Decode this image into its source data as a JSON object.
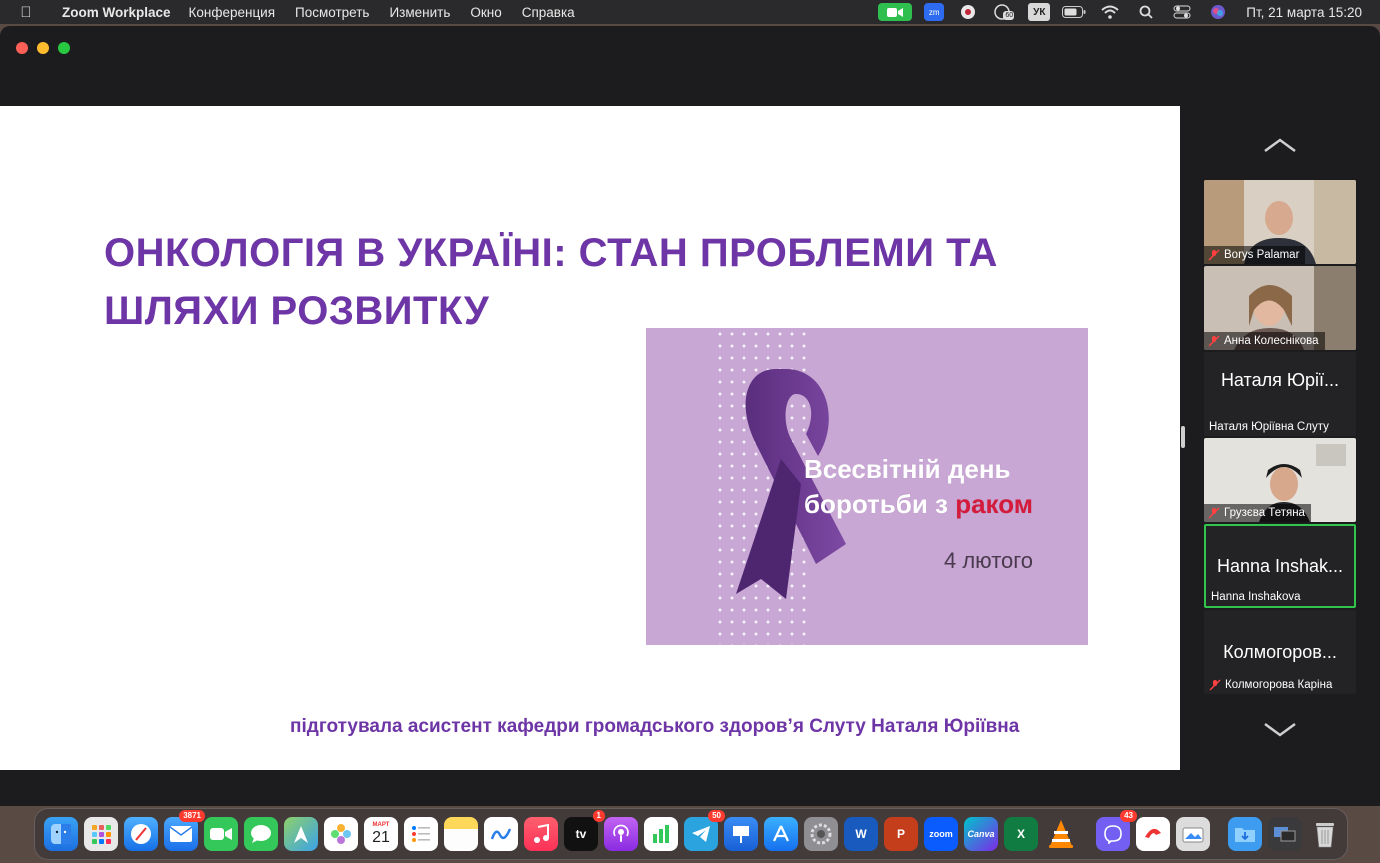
{
  "menubar": {
    "app_name": "Zoom Workplace",
    "menus": [
      "Конференция",
      "Посмотреть",
      "Изменить",
      "Окно",
      "Справка"
    ],
    "keyboard_layout": "УК",
    "notification_count": "60",
    "zm_label": "zm",
    "clock": "Пт, 21 марта  15:20"
  },
  "slide": {
    "title": "ОНКОЛОГІЯ В УКРАЇНІ: СТАН ПРОБЛЕМИ ТА ШЛЯХИ РОЗВИТКУ",
    "image_text_1": "Всесвітній день",
    "image_text_2": "боротьби з",
    "image_text_accent": "раком",
    "image_date": "4 лютого",
    "author": "підготувала асистент кафедри громадського здоров’я Слуту Наталя Юріївна",
    "colors": {
      "title": "#6d35a6",
      "ribbon": "#6b3a8f",
      "accent": "#d41b3c",
      "image_bg": "#c8a7d4"
    }
  },
  "participants": [
    {
      "label": "Borys Palamar",
      "muted": true,
      "video": true
    },
    {
      "label": "Анна Колеснікова",
      "muted": true,
      "video": true
    },
    {
      "big_name": "Наталя Юрії...",
      "label": "Наталя Юріївна Слуту",
      "muted": false,
      "video": false
    },
    {
      "label": "Грузєва Тетяна",
      "muted": true,
      "video": true
    },
    {
      "big_name": "Hanna Inshak...",
      "label": "Hanna Inshakova",
      "muted": false,
      "video": false,
      "active": true
    },
    {
      "big_name": "Колмогоров...",
      "label": "Колмогорова Каріна",
      "muted": true,
      "video": false
    }
  ],
  "dock": {
    "mail_badge": "3871",
    "calendar_month": "МАРТ",
    "calendar_day": "21",
    "tv_badge": "1",
    "tv_label": "tv",
    "telegram_badge": "50",
    "viber_badge": "43",
    "word_label": "W",
    "powerpoint_label": "P",
    "zoom_label": "zoom",
    "canva_label": "Canva",
    "excel_label": "X"
  }
}
